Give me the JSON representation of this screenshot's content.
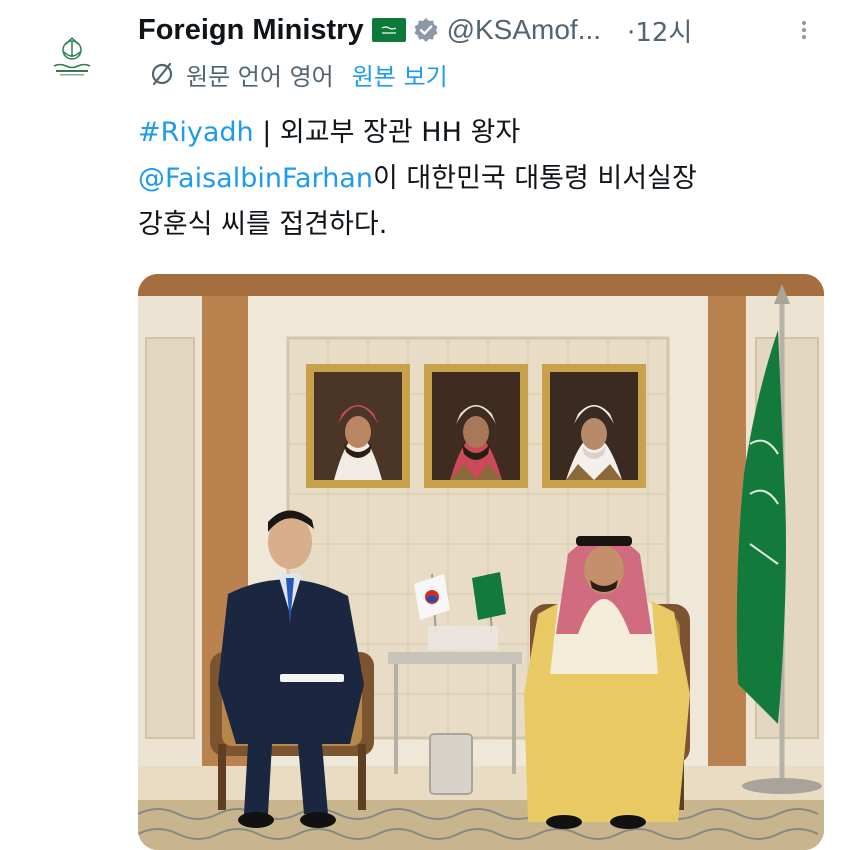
{
  "author": {
    "display_name": "Foreign Ministry",
    "flag_emoji": "saudi-flag-emoji",
    "handle": "@KSAmof...",
    "time_separator": "·",
    "timestamp": "12시"
  },
  "translation": {
    "info": "원문 언어 영어",
    "show_original": "원본 보기"
  },
  "tweet": {
    "hashtag": "#Riyadh",
    "line1_rest": " | 외교부 장관 HH 왕자",
    "mention": "@FaisalbinFarhan",
    "line2_rest": "이 대한민국 대통령 비서실장",
    "line3": "강훈식 씨를 접견하다."
  },
  "colors": {
    "link": "#1d9bf0",
    "secondary_text": "#536471",
    "saudi_green": "#0d7a3a"
  },
  "media": {
    "icon": "photo-meeting-image"
  }
}
